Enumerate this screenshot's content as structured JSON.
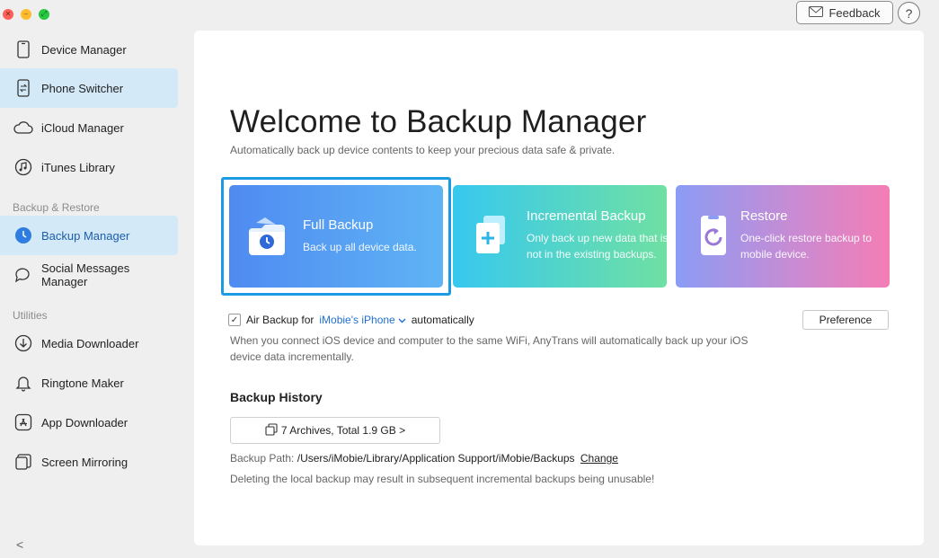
{
  "window": {
    "controls": [
      "close",
      "minimize",
      "zoom"
    ]
  },
  "toolbar": {
    "feedback_label": "Feedback",
    "help_label": "?"
  },
  "sidebar": {
    "items_top": [
      {
        "label": "Device Manager",
        "icon": "phone-icon"
      },
      {
        "label": "Phone Switcher",
        "icon": "phone-switch-icon"
      },
      {
        "label": "iCloud Manager",
        "icon": "cloud-icon"
      },
      {
        "label": "iTunes Library",
        "icon": "music-icon"
      }
    ],
    "section_backup": "Backup & Restore",
    "items_backup": [
      {
        "label": "Backup Manager",
        "icon": "backup-clock-icon"
      },
      {
        "label": "Social Messages Manager",
        "icon": "chat-icon"
      }
    ],
    "section_utilities": "Utilities",
    "items_utilities": [
      {
        "label": "Media Downloader",
        "icon": "download-icon"
      },
      {
        "label": "Ringtone Maker",
        "icon": "bell-icon"
      },
      {
        "label": "App Downloader",
        "icon": "app-store-icon"
      },
      {
        "label": "Screen Mirroring",
        "icon": "screen-mirror-icon"
      }
    ],
    "collapse_label": "<"
  },
  "main": {
    "title": "Welcome to Backup Manager",
    "subtitle": "Automatically back up device contents to keep your precious data safe & private.",
    "cards": [
      {
        "title": "Full Backup",
        "desc": "Back up all device data.",
        "icon": "full-backup-icon"
      },
      {
        "title": "Incremental Backup",
        "desc": "Only back up new data that is not in the existing backups.",
        "icon": "incremental-backup-icon"
      },
      {
        "title": "Restore",
        "desc": "One-click restore backup to mobile device.",
        "icon": "restore-icon"
      }
    ],
    "air_backup": {
      "prefix": "Air Backup for",
      "device": "iMobie's iPhone",
      "suffix": "automatically",
      "checked": true,
      "description": "When you connect iOS device and computer to the same WiFi, AnyTrans will automatically back up your iOS device data incrementally."
    },
    "preference_label": "Preference",
    "history": {
      "title": "Backup History",
      "archives_label": "7 Archives, Total  1.9 GB >",
      "path_label": "Backup Path:",
      "path_value": "/Users/iMobie/Library/Application Support/iMobie/Backups",
      "change_label": "Change",
      "warning": "Deleting the local backup may result in subsequent incremental backups being unusable!"
    }
  },
  "colors": {
    "accent_blue": "#1a9be3",
    "link_blue": "#1f6fd1",
    "sidebar_selected": "#d4e9f8"
  }
}
